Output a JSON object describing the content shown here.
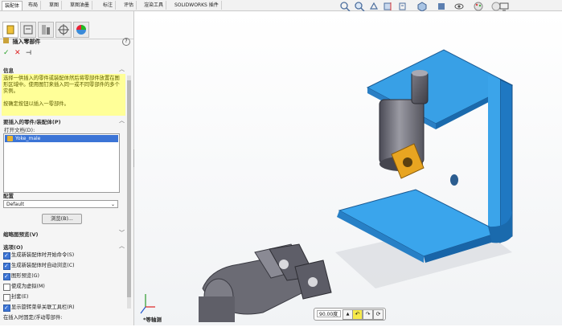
{
  "tabs": [
    "装配体",
    "布局",
    "草图",
    "草图油墨",
    "标注",
    "评估",
    "渲染工具",
    "SOLIDWORKS 插件"
  ],
  "pm": {
    "title": "插入零部件",
    "help": "?",
    "ok": "✓",
    "cancel": "✕",
    "pin": "⊣",
    "message": {
      "header": "信息",
      "line1": "选择一供插入的零件或装配体然后将零部件放置在图形区域中。使用图钉来插入同一或不同零部件的多个实例。",
      "line2": "按确定按钮以插入一零部件。"
    },
    "parts": {
      "header": "要插入的零件/装配体(P)",
      "open_label": "打开文档(D):",
      "item": "Yoke_male"
    },
    "config": {
      "label": "配置",
      "value": "Default"
    },
    "browse": "浏览(B)...",
    "thumb_section": "缩略图预览(V)",
    "options_header": "选项(O)",
    "options": [
      {
        "label": "生成新装配体时开始命令(S)",
        "checked": true
      },
      {
        "label": "生成新装配体时自动浏览(C)",
        "checked": true
      },
      {
        "label": "图形预览(G)",
        "checked": true
      },
      {
        "label": "使成为虚拟(M)",
        "checked": false
      },
      {
        "label": "封套(E)",
        "checked": false
      },
      {
        "label": "显示旋转菜单关联工具栏(R)",
        "checked": true
      }
    ],
    "bottom_option": "在插入时固定/浮动零部件:"
  },
  "rotate": {
    "value": "90.00度"
  },
  "view_name": "*等轴测",
  "colors": {
    "bracket": "#2f8fd4",
    "bracket_dark": "#1a5f9e",
    "selection": "#3b74d6",
    "message_bg": "#ffff98"
  }
}
